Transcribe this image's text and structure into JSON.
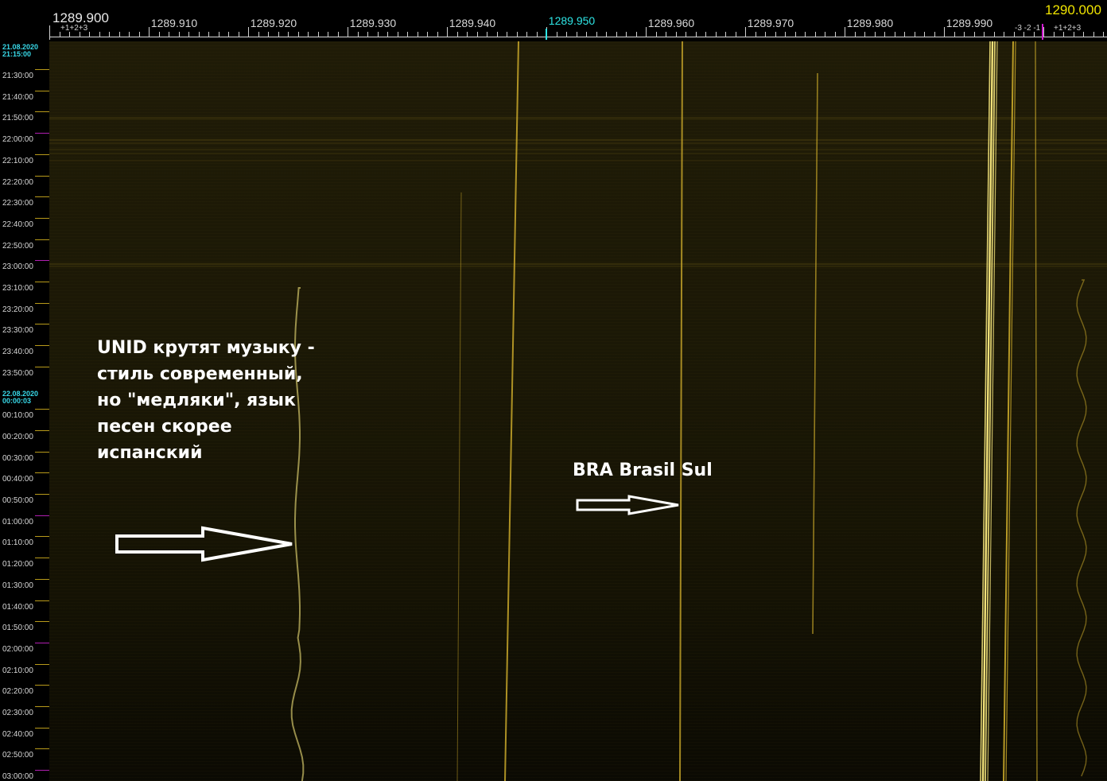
{
  "scale": {
    "start_label": "1289.900",
    "start_sub": "+1+2+3",
    "center_label": "1289.950",
    "end_label": "1290.000",
    "end_sub_left": "-3 -2 -1",
    "end_sub_right": "+1+2+3",
    "labels": [
      "1289.910",
      "1289.920",
      "1289.930",
      "1289.940",
      "1289.960",
      "1289.970",
      "1289.980",
      "1289.990"
    ]
  },
  "time_axis": {
    "date_start": "21.08.2020",
    "time_start": "21:15:00",
    "date_mid": "22.08.2020",
    "time_mid": "00:00:03",
    "times": [
      "21:30:00",
      "21:40:00",
      "21:50:00",
      "22:00:00",
      "22:10:00",
      "22:20:00",
      "22:30:00",
      "22:40:00",
      "22:50:00",
      "23:00:00",
      "23:10:00",
      "23:20:00",
      "23:30:00",
      "23:40:00",
      "23:50:00",
      "00:10:00",
      "00:20:00",
      "00:30:00",
      "00:40:00",
      "00:50:00",
      "01:00:00",
      "01:10:00",
      "01:20:00",
      "01:30:00",
      "01:40:00",
      "01:50:00",
      "02:00:00",
      "02:10:00",
      "02:20:00",
      "02:30:00",
      "02:40:00",
      "02:50:00",
      "03:00:00"
    ]
  },
  "annotations": {
    "unid_note": [
      "UNID крутят музыку  -",
      "стиль современный,",
      "но \"медляки\", язык",
      "песен скорее",
      "испанский"
    ],
    "bra_note": "BRA Brasil Sul"
  },
  "colors": {
    "waterfall_bg": "#1b1806",
    "trace": "#c9a82a",
    "trace_bright": "#f2e27a",
    "center_marker": "#2ee6e6",
    "hour_marker": "#b01fb0",
    "end_label": "#f0e400",
    "arrow": "#ffffff"
  }
}
